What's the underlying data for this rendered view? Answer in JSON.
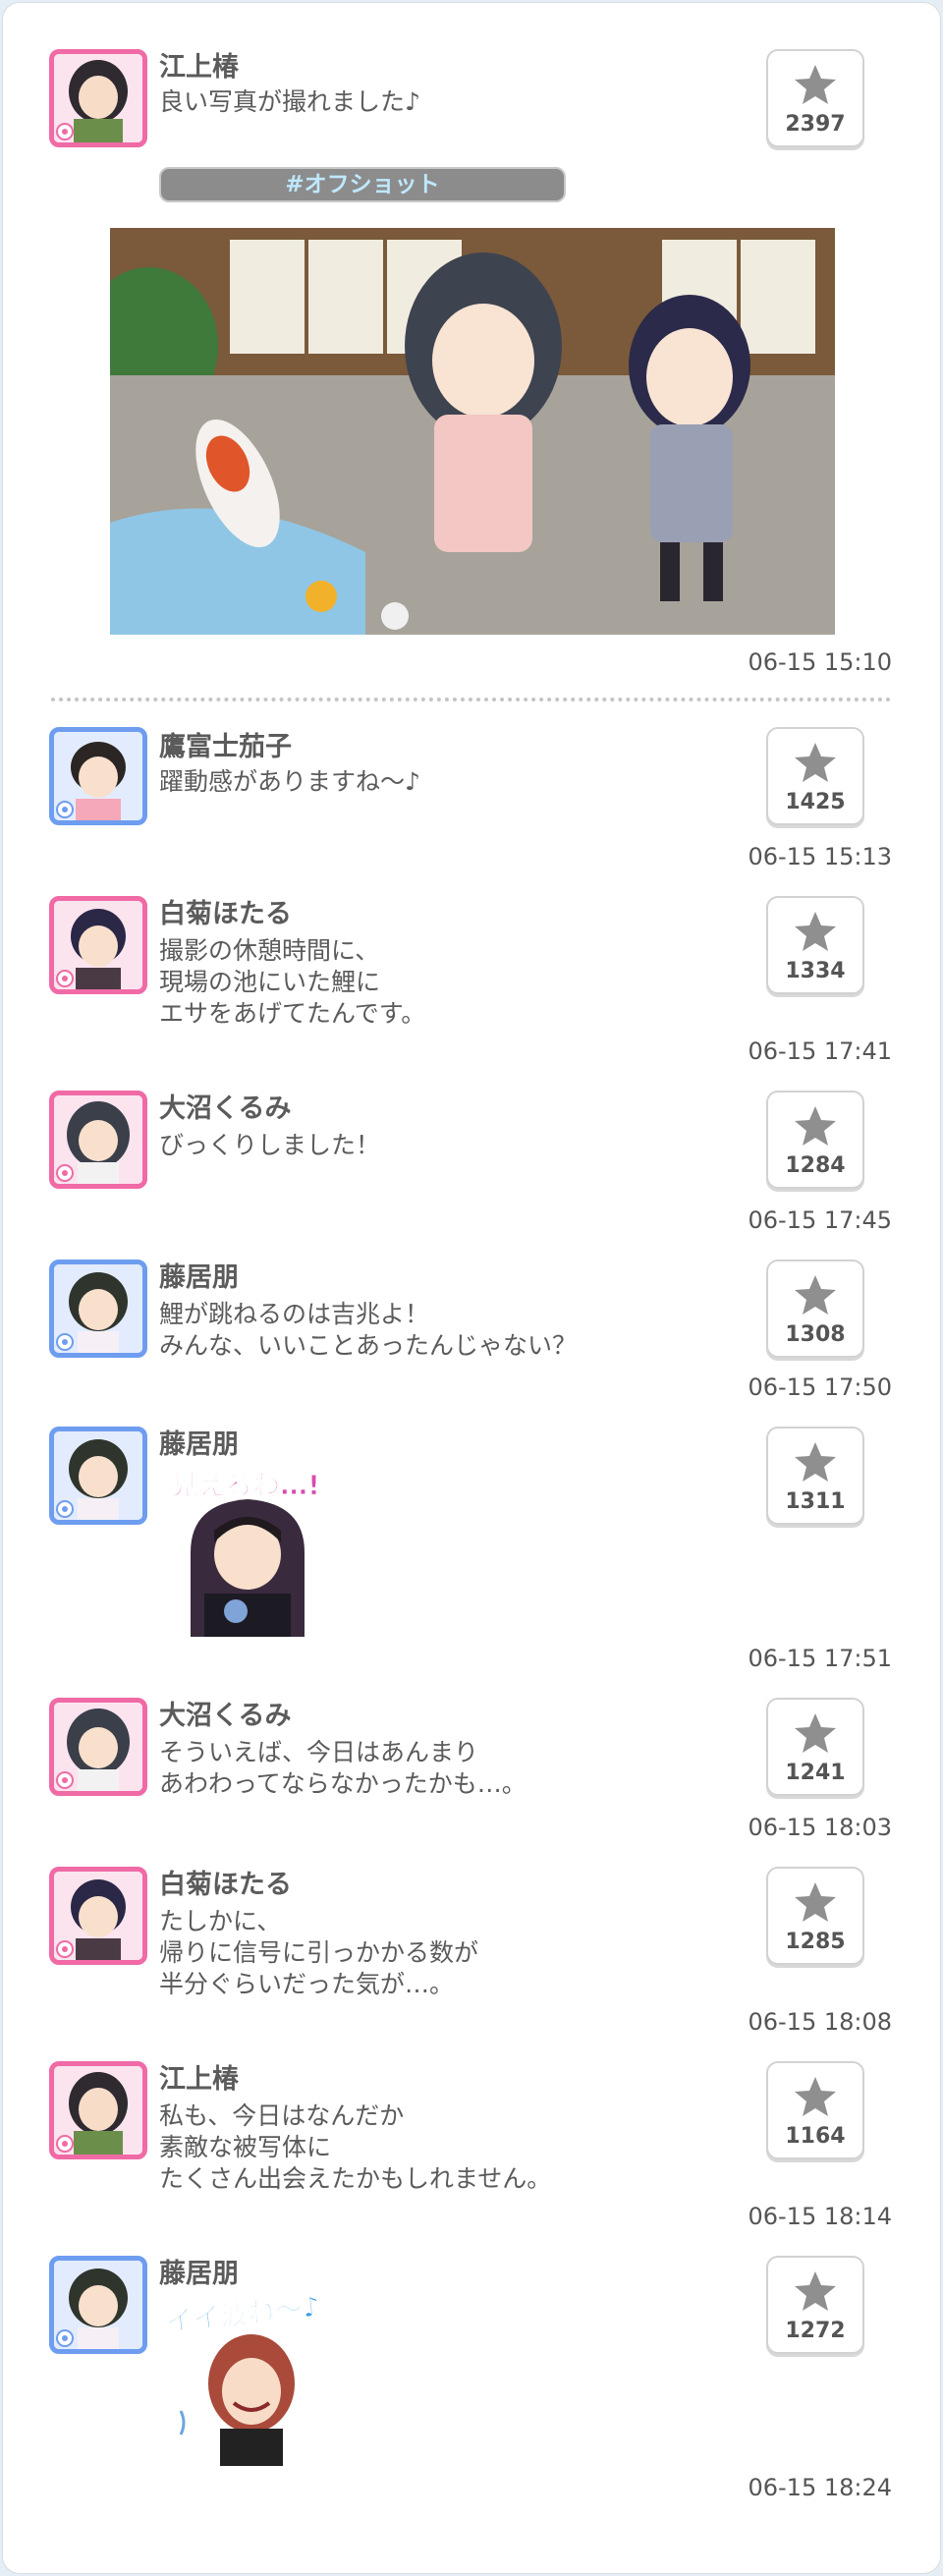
{
  "post": {
    "name": "江上椿",
    "text": "良い写真が撮れました♪",
    "likes": "2397",
    "hashtag": "#オフショット",
    "time": "06-15 15:10"
  },
  "comments": [
    {
      "name": "鷹富士茄子",
      "text": "躍動感がありますね～♪",
      "likes": "1425",
      "time": "06-15 15:13"
    },
    {
      "name": "白菊ほたる",
      "text": "撮影の休憩時間に、\n現場の池にいた鯉に\nエサをあげてたんです。",
      "likes": "1334",
      "time": "06-15 17:41"
    },
    {
      "name": "大沼くるみ",
      "text": "びっくりしました！",
      "likes": "1284",
      "time": "06-15 17:45"
    },
    {
      "name": "藤居朋",
      "text": "鯉が跳ねるのは吉兆よ！\nみんな、いいことあったんじゃない？",
      "likes": "1308",
      "time": "06-15 17:50"
    },
    {
      "name": "藤居朋",
      "sticker_text": "見えるわ…!",
      "likes": "1311",
      "time": "06-15 17:51"
    },
    {
      "name": "大沼くるみ",
      "text": "そういえば、今日はあんまり\nあわわってならなかったかも…。",
      "likes": "1241",
      "time": "06-15 18:03"
    },
    {
      "name": "白菊ほたる",
      "text": "たしかに、\n帰りに信号に引っかかる数が\n半分ぐらいだった気が…。",
      "likes": "1285",
      "time": "06-15 18:08"
    },
    {
      "name": "江上椿",
      "text": "私も、今日はなんだか\n素敵な被写体に\nたくさん出会えたかもしれません。",
      "likes": "1164",
      "time": "06-15 18:14"
    },
    {
      "name": "藤居朋",
      "sticker_text": "イイ波ね～♪",
      "likes": "1272",
      "time": "06-15 18:24"
    }
  ],
  "icons": {
    "like": "star-icon"
  },
  "colors": {
    "cute_frame": "#f06aa6",
    "cool_frame": "#6e9df0",
    "tag_bg": "#8c8c8c",
    "tag_text": "#bfe8ff"
  }
}
